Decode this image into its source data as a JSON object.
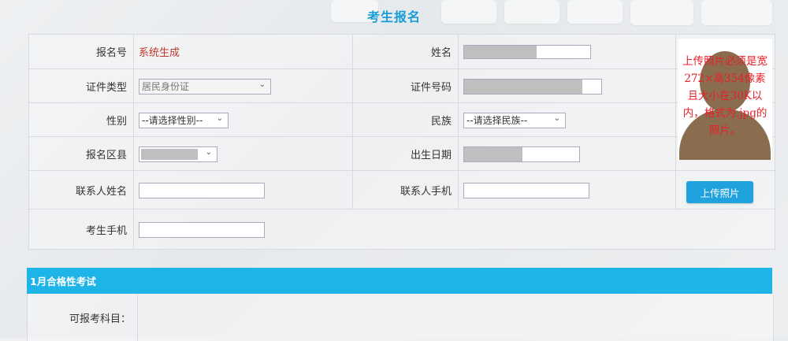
{
  "page": {
    "title": "考生报名"
  },
  "form": {
    "reg_no": {
      "label": "报名号",
      "value": "系统生成"
    },
    "name": {
      "label": "姓名",
      "value": ""
    },
    "id_type": {
      "label": "证件类型",
      "value": "居民身份证"
    },
    "id_no": {
      "label": "证件号码",
      "value": ""
    },
    "gender": {
      "label": "性别",
      "value": "--请选择性别--"
    },
    "ethnicity": {
      "label": "民族",
      "value": "--请选择民族--"
    },
    "district": {
      "label": "报名区县",
      "value": ""
    },
    "birth_date": {
      "label": "出生日期",
      "value": ""
    },
    "contact_name": {
      "label": "联系人姓名",
      "value": ""
    },
    "contact_phone": {
      "label": "联系人手机",
      "value": ""
    },
    "candidate_phone": {
      "label": "考生手机",
      "value": ""
    }
  },
  "photo": {
    "notice": "上传照片必须是宽272×高354像素且大小在30K以内，格式为.jpg的照片。",
    "upload_label": "上传照片"
  },
  "exam_section": {
    "title": "1月合格性考试",
    "subjects_label": "可报考科目："
  },
  "colors": {
    "title": "#1a9cd6",
    "section_bar": "#1fb4e8",
    "button": "#1fa2dd",
    "notice_red": "#e8202a",
    "reg_no_red": "#c0392b"
  }
}
